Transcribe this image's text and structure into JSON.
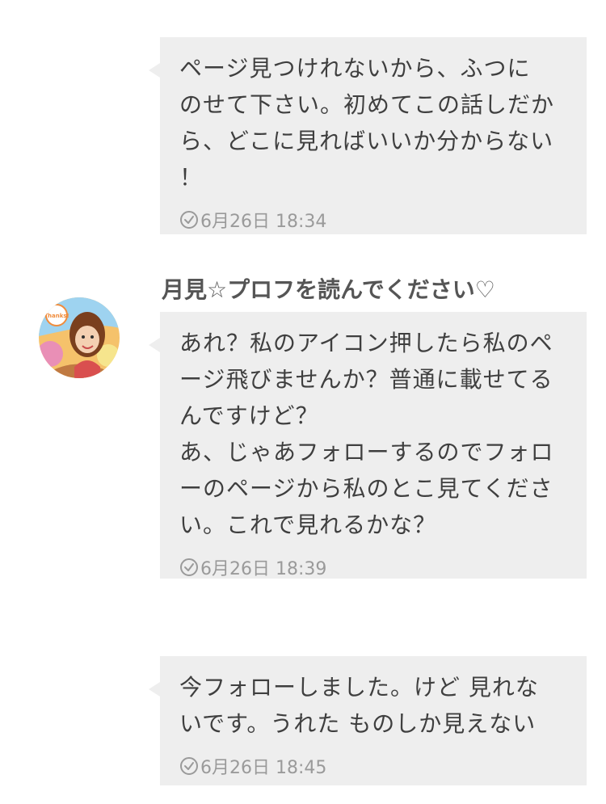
{
  "messages": [
    {
      "text": "ページ見つけれないから、ふつに\nのせて下さい。初めてこの話しだか\nら、どこに見ればいいか分からない\n！",
      "time": "6月26日 18:34"
    },
    {
      "sender": "月見☆プロフを読んでください♡",
      "avatar_badge": "Thanks!",
      "text": "あれ？私のアイコン押したら私のペ\nージ飛びませんか？普通に載せてる\nんですけど？\nあ、じゃあフォローするのでフォロ\nーのページから私のとこ見てくださ\nい。これで見れるかな？",
      "time": "6月26日 18:39"
    },
    {
      "text": "今フォローしました。けど 見れな\nいです。うれた ものしか見えない",
      "time": "6月26日 18:45"
    }
  ],
  "colors": {
    "bubble": "#eeeeee",
    "text": "#3f3f3f",
    "timestamp": "#9a9a9a"
  },
  "icons": {
    "timestamp": "clock-icon"
  }
}
